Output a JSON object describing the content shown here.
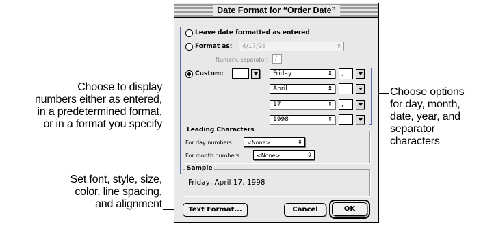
{
  "callouts": {
    "left_top": [
      "Choose to display",
      "numbers either as entered,",
      "in a predetermined format,",
      "or in a format you specify"
    ],
    "left_bottom": [
      "Set font, style, size,",
      "color, line spacing,",
      "and alignment"
    ],
    "right": [
      "Choose options",
      "for day, month,",
      "date, year, and",
      "separator",
      "characters"
    ]
  },
  "dialog": {
    "title": "Date Format for “Order Date”",
    "options": {
      "leave": "Leave date formatted as entered",
      "format_as": "Format as:",
      "format_as_value": "4/17/98",
      "numeric_separator_label": "Numeric separator:",
      "numeric_separator_value": "/",
      "custom": "Custom:",
      "selected": "custom"
    },
    "custom_rows": [
      {
        "value": "Friday",
        "separator": ","
      },
      {
        "value": "April",
        "separator": ""
      },
      {
        "value": "17",
        "separator": ","
      },
      {
        "value": "1998",
        "separator": ""
      }
    ],
    "leading": {
      "title": "Leading Characters",
      "day_label": "For day numbers:",
      "day_value": "<None>",
      "month_label": "For month numbers:",
      "month_value": "<None>"
    },
    "sample": {
      "title": "Sample",
      "text": "Friday, April 17, 1998"
    },
    "buttons": {
      "text_format": "Text Format...",
      "cancel": "Cancel",
      "ok": "OK"
    }
  },
  "colors": {
    "dialog_bg": "#e8e8e8",
    "bracket": "#5a6aaa"
  }
}
